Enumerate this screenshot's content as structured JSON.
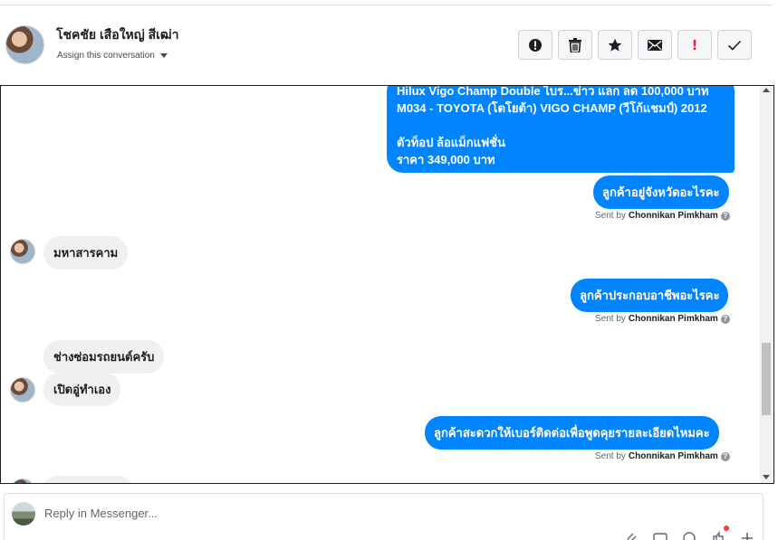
{
  "header": {
    "contact_name": "โชคชัย เสือใหญ่ สีเฒ่า",
    "assign_label": "Assign this conversation"
  },
  "actions": [
    {
      "name": "mark-spam-button",
      "icon": "alert-circle-icon"
    },
    {
      "name": "delete-button",
      "icon": "trash-icon"
    },
    {
      "name": "star-button",
      "icon": "star-icon"
    },
    {
      "name": "mark-unread-button",
      "icon": "envelope-icon"
    },
    {
      "name": "follow-up-button",
      "icon": "exclamation-icon",
      "glyph": "!"
    },
    {
      "name": "mark-done-button",
      "icon": "check-icon"
    }
  ],
  "messages": {
    "big_out": {
      "line1": "Hilux Vigo Champ Double ไบร...ข่าว แลก ลด 100,000 บาท",
      "line2": "M034 - TOYOTA (โตโยต้า) VIGO CHAMP (วีโก้แชมป์) 2012",
      "line3": "ตัวท็อป ล้อแม็กแฟชั่น",
      "line4": "ราคา 349,000 บาท"
    },
    "out1": "ลูกค้าอยู่จังหวัดอะไรคะ",
    "in1": "มหาสารคาม",
    "out2": "ลูกค้าประกอบอาชีพอะไรคะ",
    "in2": "ช่างซ่อมรถยนต์ครับ",
    "in3": "เปิดอู่ทำเอง",
    "out3": "ลูกค้าสะดวกให้เบอร์ติดต่อเพื่อพูดคุยรายละเอียดไหมคะ",
    "sent_by_prefix": "Sent by",
    "sent_by_name": "Chonnikan Pimkham"
  },
  "composer": {
    "placeholder": "Reply in Messenger..."
  },
  "colors": {
    "messenger_blue": "#0084ff",
    "incoming_gray": "#f1f0f0",
    "alert_red": "#e41e3f"
  }
}
